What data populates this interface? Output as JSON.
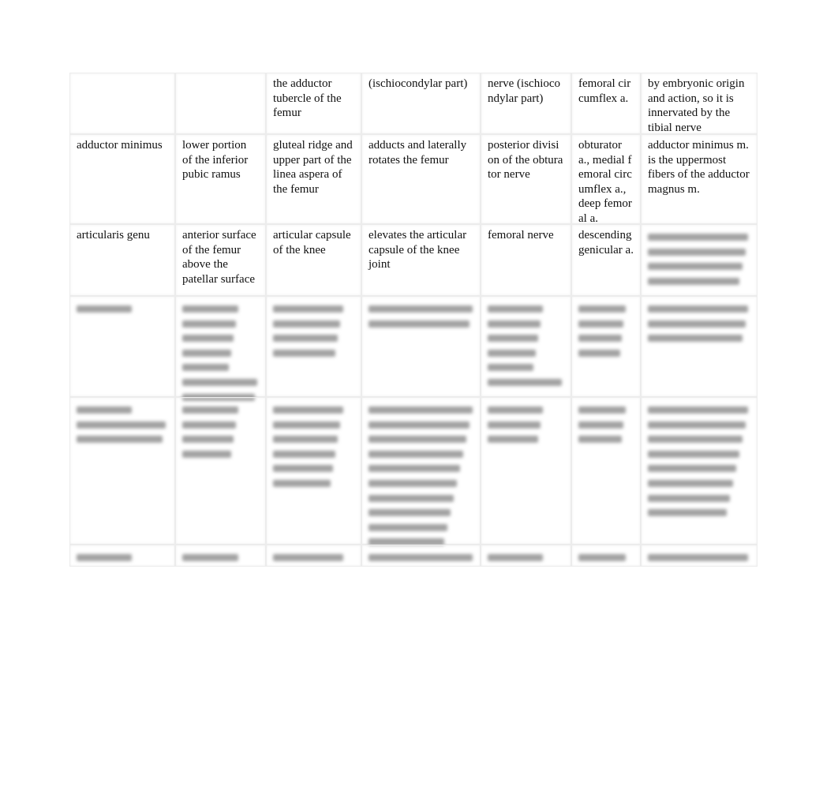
{
  "table": {
    "rows": [
      [
        "",
        "",
        "the adductor tubercle of the femur",
        "(ischiocondylar part)",
        "nerve (ischiocondylar part)",
        "femoral circumflex a.",
        "by embryonic origin and action, so it is innervated by the tibial nerve"
      ],
      [
        "adductor minimus",
        "lower portion of the inferior pubic ramus",
        "gluteal ridge and upper part of the linea aspera of the femur",
        "adducts and laterally rotates the femur",
        "posterior division of the obturator nerve",
        "obturator a., medial femoral circumflex a., deep femoral a.",
        "adductor minimus m. is the uppermost fibers of the adductor magnus m."
      ],
      [
        "articularis genu",
        "anterior surface of the femur above the patellar surface",
        "articular capsule of the knee",
        "elevates the articular capsule of the knee joint",
        "femoral nerve",
        "descending genicular a.",
        null
      ],
      [
        null,
        null,
        null,
        null,
        null,
        null,
        null
      ],
      [
        null,
        null,
        null,
        null,
        null,
        null,
        null
      ],
      [
        null,
        null,
        null,
        null,
        null,
        null,
        null
      ]
    ]
  }
}
